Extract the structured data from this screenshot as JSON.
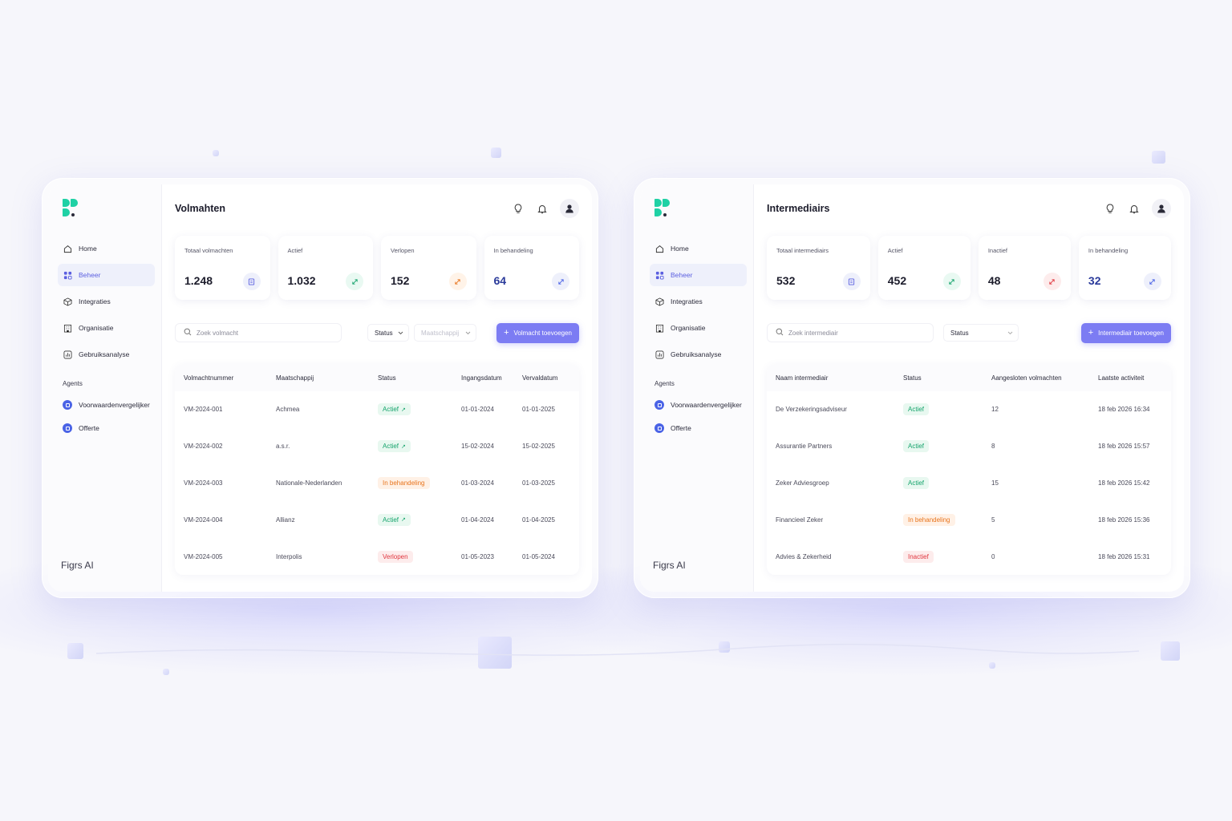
{
  "colors": {
    "accent": "#7c7cf3",
    "brand": "#1fd1a5",
    "active_nav": "#5b5fe0",
    "green": "#14a36b",
    "orange": "#e8741c",
    "red": "#e0363f"
  },
  "left": {
    "brand": "Figrs AI",
    "nav": [
      {
        "label": "Home",
        "icon": "home-icon"
      },
      {
        "label": "Beheer",
        "icon": "grid-icon",
        "active": true
      },
      {
        "label": "Integraties",
        "icon": "cube-icon"
      },
      {
        "label": "Organisatie",
        "icon": "building-icon"
      },
      {
        "label": "Gebruiksanalyse",
        "icon": "chart-icon"
      }
    ],
    "agents_label": "Agents",
    "agents": [
      "Voorwaardenvergelijker",
      "Offerte"
    ],
    "title": "Volmahten",
    "stats": [
      {
        "label": "Totaal volmachten",
        "value": "1.248"
      },
      {
        "label": "Actief",
        "value": "1.032"
      },
      {
        "label": "Verlopen",
        "value": "152"
      },
      {
        "label": "In behandeling",
        "value": "64"
      }
    ],
    "search_placeholder": "Zoek volmacht",
    "filter_status": "Status",
    "filter_company": "Maatschappij",
    "add_button": "Volmacht toevoegen",
    "columns": [
      "Volmachtnummer",
      "Maatschappij",
      "Status",
      "Ingangsdatum",
      "Vervaldatum"
    ],
    "rows": [
      [
        "VM-2024-001",
        "Achmea",
        "Actief",
        "01-01-2024",
        "01-01-2025"
      ],
      [
        "VM-2024-002",
        "a.s.r.",
        "Actief",
        "15-02-2024",
        "15-02-2025"
      ],
      [
        "VM-2024-003",
        "Nationale-Nederlanden",
        "In behandeling",
        "01-03-2024",
        "01-03-2025"
      ],
      [
        "VM-2024-004",
        "Allianz",
        "Actief",
        "01-04-2024",
        "01-04-2025"
      ],
      [
        "VM-2024-005",
        "Interpolis",
        "Verlopen",
        "01-05-2023",
        "01-05-2024"
      ]
    ]
  },
  "right": {
    "brand": "Figrs AI",
    "nav": [
      {
        "label": "Home",
        "icon": "home-icon"
      },
      {
        "label": "Beheer",
        "icon": "grid-icon",
        "active": true
      },
      {
        "label": "Integraties",
        "icon": "cube-icon"
      },
      {
        "label": "Organisatie",
        "icon": "building-icon"
      },
      {
        "label": "Gebruiksanalyse",
        "icon": "chart-icon"
      }
    ],
    "agents_label": "Agents",
    "agents": [
      "Voorwaardenvergelijker",
      "Offerte"
    ],
    "title": "Intermediairs",
    "stats": [
      {
        "label": "Totaal intermediairs",
        "value": "532"
      },
      {
        "label": "Actief",
        "value": "452"
      },
      {
        "label": "Inactief",
        "value": "48"
      },
      {
        "label": "In behandeling",
        "value": "32"
      }
    ],
    "search_placeholder": "Zoek intermediair",
    "filter_status": "Status",
    "add_button": "Intermediair toevoegen",
    "columns": [
      "Naam intermediair",
      "Status",
      "Aangesloten volmachten",
      "Laatste activiteit"
    ],
    "rows": [
      [
        "De Verzekeringsadviseur",
        "Actief",
        "12",
        "18 feb 2026 16:34"
      ],
      [
        "Assurantie Partners",
        "Actief",
        "8",
        "18 feb 2026 15:57"
      ],
      [
        "Zeker Adviesgroep",
        "Actief",
        "15",
        "18 feb 2026 15:42"
      ],
      [
        "Financieel Zeker",
        "In behandeling",
        "5",
        "18 feb 2026 15:36"
      ],
      [
        "Advies & Zekerheid",
        "Inactief",
        "0",
        "18 feb 2026 15:31"
      ]
    ]
  }
}
